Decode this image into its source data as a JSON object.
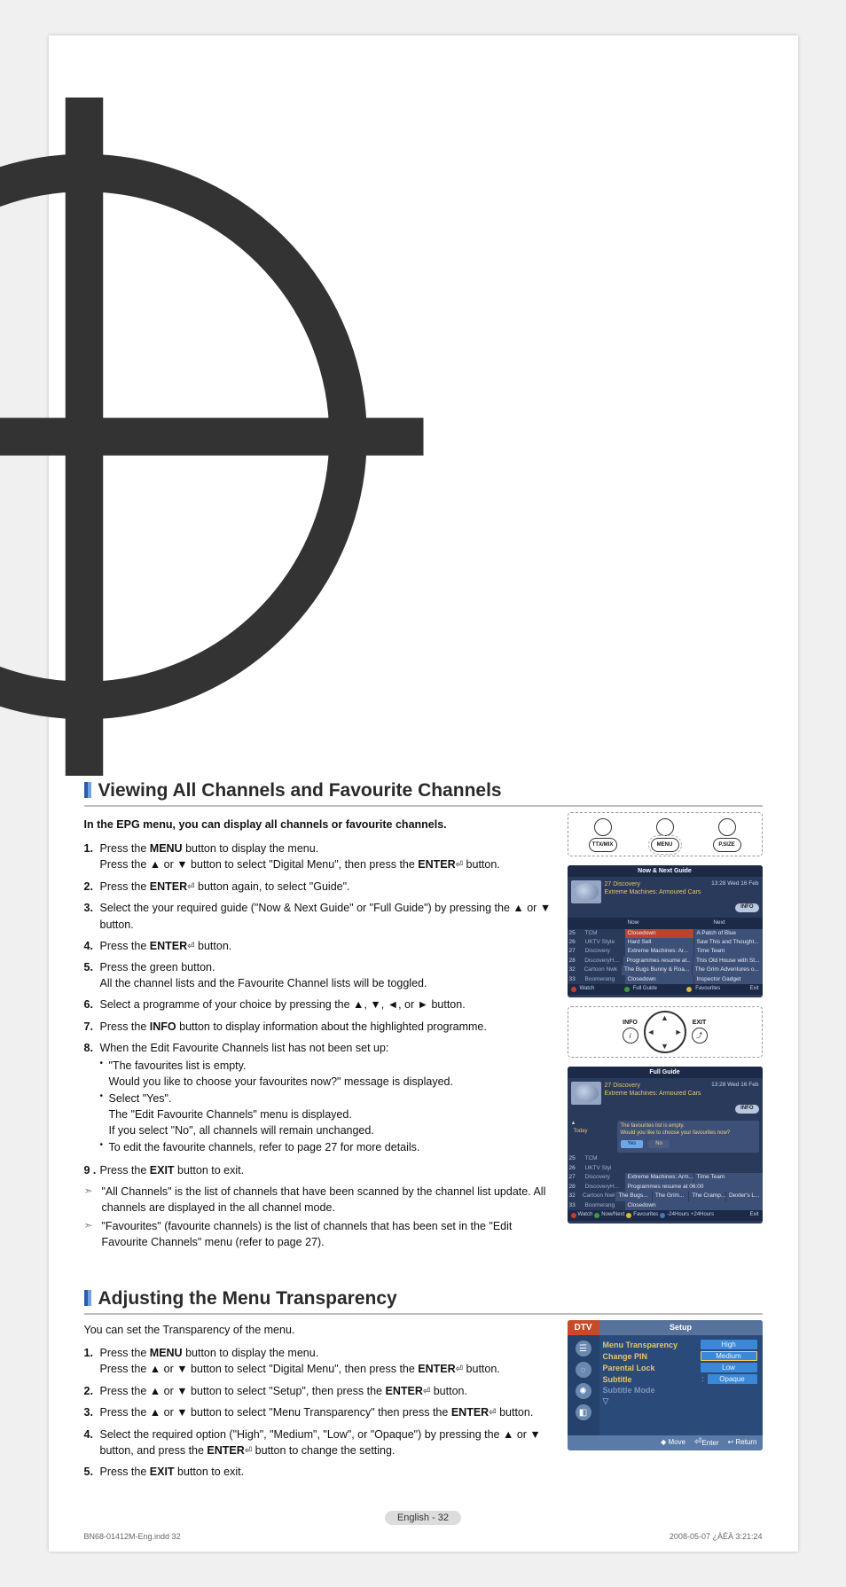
{
  "page": {
    "number_label": "English - 32",
    "print_file": "BN68-01412M-Eng.indd   32",
    "print_stamp": "2008-05-07   ¿ÀÈÄ 3:21:24"
  },
  "section1": {
    "title": "Viewing All Channels and Favourite Channels",
    "intro": "In the EPG menu, you can display all channels or favourite channels.",
    "steps": [
      {
        "num": "1.",
        "html": "Press the <span class='b'>MENU</span> button to display the menu.<br>Press the ▲ or ▼ button to select \"Digital Menu\", then press the <span class='b'>ENTER</span><span class='enter-icon'>⏎</span> button."
      },
      {
        "num": "2.",
        "html": "Press the <span class='b'>ENTER</span><span class='enter-icon'>⏎</span> button again, to select \"Guide\"."
      },
      {
        "num": "3.",
        "html": "Select the your required guide (\"Now & Next Guide\" or \"Full Guide\") by pressing the ▲ or ▼ button."
      },
      {
        "num": "4.",
        "html": "Press the <span class='b'>ENTER</span><span class='enter-icon'>⏎</span> button."
      },
      {
        "num": "5.",
        "html": "Press the green button.<br>All the channel lists and the Favourite Channel lists will be toggled."
      },
      {
        "num": "6.",
        "html": "Select a programme of your choice by pressing the ▲, ▼, ◄, or ► button."
      },
      {
        "num": "7.",
        "html": "Press the <span class='b'>INFO</span> button to display information about the highlighted programme."
      },
      {
        "num": "8.",
        "html": "When the Edit Favourite Channels list has not been set up:",
        "sub": [
          "\"The favourites list is empty.<br>Would you like to choose your favourites now?\" message is displayed.",
          "Select \"Yes\".<br>The \"Edit Favourite Channels\" menu is displayed.<br>If you select \"No\", all channels will remain unchanged.",
          "To edit the favourite channels, refer to page 27 for more details."
        ]
      },
      {
        "num": "9 .",
        "html": "Press the <span class='b'>EXIT</span> button to exit."
      }
    ],
    "notes": [
      "\"All Channels\" is the list of channels that have been scanned by the channel list update. All channels are displayed in the all channel mode.",
      "\"Favourites\" (favourite channels) is the list of channels that has been set in the \"Edit Favourite Channels\" menu (refer to page 27)."
    ],
    "remote1": {
      "btn_left": "TTX/MIX",
      "btn_mid": "MENU",
      "btn_right": "P.SIZE"
    },
    "remote2": {
      "left_label": "INFO",
      "right_label": "EXIT"
    },
    "guide1": {
      "title": "Now & Next Guide",
      "channel": "27 Discovery",
      "programme": "Extreme Machines: Armoured Cars",
      "time": "13:28  Wed 16 Feb",
      "info": "INFO",
      "col_now": "Now",
      "col_next": "Next",
      "rows": [
        {
          "num": "25",
          "name": "TCM",
          "a": "Closedown",
          "b": "A Patch of Blue"
        },
        {
          "num": "26",
          "name": "UKTV Style",
          "a": "Hard Sell",
          "b": "Saw This and Thought..."
        },
        {
          "num": "27",
          "name": "Discovery",
          "a": "Extreme Machines: Ar...",
          "b": "Time Team"
        },
        {
          "num": "28",
          "name": "DiscoveryH...",
          "a": "Programmes resume at..",
          "b": "This Old House with St..."
        },
        {
          "num": "32",
          "name": "Cartoon Nwk",
          "a": "The Bugs Bunny & Roa...",
          "b": "The Grim Adventures o..."
        },
        {
          "num": "33",
          "name": "Boomerang",
          "a": "Closedown",
          "b": "Inspector Gadget"
        }
      ],
      "footer": {
        "watch": "Watch",
        "full": "Full Guide",
        "fav": "Favourites",
        "exit": "Exit"
      }
    },
    "guide2": {
      "title": "Full Guide",
      "channel": "27 Discovery",
      "programme": "Extreme Machines: Armoured Cars",
      "time": "13:28  Wed 16 Feb",
      "info": "INFO",
      "today": "Today",
      "dialog": {
        "line1": "The favourites list is empty.",
        "line2": "Would you like to choose your favourites now?",
        "yes": "Yes",
        "no": "No"
      },
      "rows": [
        {
          "num": "25",
          "name": "TCM"
        },
        {
          "num": "26",
          "name": "UKTV Styl"
        },
        {
          "num": "27",
          "name": "Discovery",
          "a": "Extreme Machines: Arm...",
          "b": "Time Team"
        },
        {
          "num": "28",
          "name": "DiscoveryH...",
          "a": "Programmes resume at 06:00"
        },
        {
          "num": "32",
          "name": "Cartoon Nwk",
          "a": "The Bugs...",
          "b": "The Grim...",
          "c": "The Cramp...",
          "d": "Dexter's L..."
        },
        {
          "num": "33",
          "name": "Boomerang",
          "a": "Closedown"
        }
      ],
      "footer": {
        "watch": "Watch",
        "nn": "Now/Next",
        "fav": "Favourites",
        "m24": "-24Hours",
        "p24": "+24Hours",
        "exit": "Exit"
      }
    }
  },
  "section2": {
    "title": "Adjusting the Menu Transparency",
    "desc": "You can set the Transparency of the menu.",
    "steps": [
      {
        "num": "1.",
        "html": "Press the <span class='b'>MENU</span> button to display the menu.<br>Press the ▲ or ▼ button to select \"Digital Menu\", then press the <span class='b'>ENTER</span><span class='enter-icon'>⏎</span> button."
      },
      {
        "num": "2.",
        "html": "Press the ▲ or ▼ button to select \"Setup\", then press the <span class='b'>ENTER</span><span class='enter-icon'>⏎</span> button."
      },
      {
        "num": "3.",
        "html": "Press the ▲ or ▼ button to select \"Menu Transparency\" then press the <span class='b'>ENTER</span><span class='enter-icon'>⏎</span> button."
      },
      {
        "num": "4.",
        "html": "Select the required option (\"High\", \"Medium\", \"Low\", or \"Opaque\") by pressing the ▲ or ▼ button, and press the <span class='b'>ENTER</span><span class='enter-icon'>⏎</span> button to change the setting."
      },
      {
        "num": "5.",
        "html": "Press the <span class='b'>EXIT</span> button to exit."
      }
    ],
    "setup": {
      "dtv": "DTV",
      "title": "Setup",
      "menu_items": {
        "transparency": "Menu Transparency",
        "pin": "Change PIN",
        "parental": "Parental Lock",
        "subtitle": "Subtitle",
        "subtitle_mode": "Subtitle  Mode",
        "more": "▽"
      },
      "options": {
        "high": "High",
        "medium": "Medium",
        "low": "Low",
        "opaque": "Opaque",
        "colon": ":"
      },
      "nav": {
        "move": "Move",
        "enter": "Enter",
        "return": "Return"
      }
    }
  }
}
